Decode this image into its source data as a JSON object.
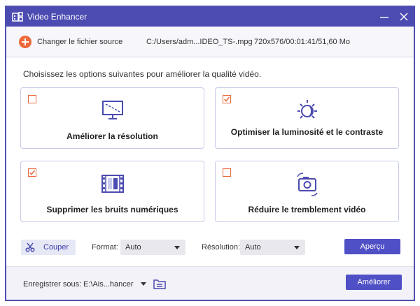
{
  "window": {
    "title": "Video Enhancer",
    "app_icon": "video-enhancer-app-icon",
    "accent_color": "#4b4bb1"
  },
  "source": {
    "change_label": "Changer le fichier source",
    "file_path": "C:/Users/adm...IDEO_TS-.mpg",
    "file_info": "720x576/00:01:41/51,60 Mo"
  },
  "instruction": "Choisissez les options suivantes pour améliorer la qualité vidéo.",
  "options": [
    {
      "label": "Améliorer la résolution",
      "checked": false,
      "icon": "monitor-resolution-icon"
    },
    {
      "label": "Optimiser la luminosité et le contraste",
      "checked": true,
      "icon": "brightness-icon"
    },
    {
      "label": "Supprimer les bruits numériques",
      "checked": true,
      "icon": "film-noise-icon"
    },
    {
      "label": "Réduire le tremblement vidéo",
      "checked": false,
      "icon": "camera-shake-icon"
    }
  ],
  "controls": {
    "cut_label": "Couper",
    "format_label": "Format:",
    "format_value": "Auto",
    "resolution_label": "Résolution:",
    "resolution_value": "Auto",
    "preview_label": "Aperçu"
  },
  "footer": {
    "save_label": "Enregistrer sous:",
    "save_path": "E:\\Ais...hancer",
    "enhance_label": "Améliorer"
  },
  "colors": {
    "checkbox": "#e8693a",
    "icon_stroke": "#4b4bb1",
    "primary_button": "#4f4fc6",
    "add_button": "#ef6a3a"
  }
}
